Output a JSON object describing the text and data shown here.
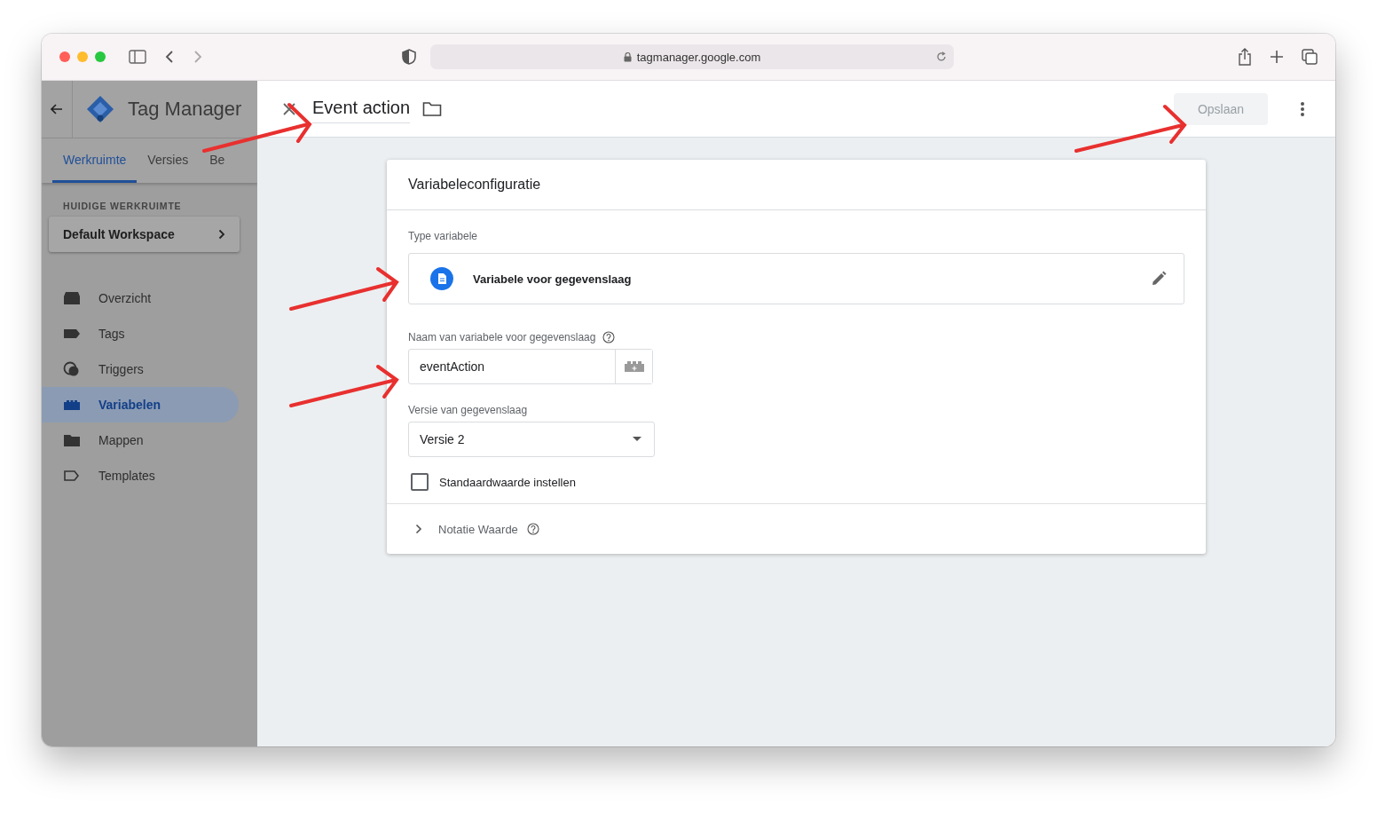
{
  "browser": {
    "url": "tagmanager.google.com"
  },
  "gtm": {
    "app_title": "Tag Manager",
    "tabs": [
      {
        "label": "Werkruimte",
        "selected": true
      },
      {
        "label": "Versies",
        "selected": false
      },
      {
        "label": "Be",
        "selected": false
      }
    ],
    "workspace_heading": "HUIDIGE WERKRUIMTE",
    "workspace": "Default Workspace",
    "nav": [
      {
        "label": "Overzicht",
        "selected": false
      },
      {
        "label": "Tags",
        "selected": false
      },
      {
        "label": "Triggers",
        "selected": false
      },
      {
        "label": "Variabelen",
        "selected": true
      },
      {
        "label": "Mappen",
        "selected": false
      },
      {
        "label": "Templates",
        "selected": false
      }
    ]
  },
  "editor": {
    "title": "Event action",
    "save_button": {
      "label": "Opslaan",
      "disabled": true
    },
    "card": {
      "title": "Variabeleconfiguratie",
      "type_label": "Type variabele",
      "type_value": "Variabele voor gegevenslaag",
      "name_label": "Naam van variabele voor gegevenslaag",
      "name_value": "eventAction",
      "version_label": "Versie van gegevenslaag",
      "version_value": "Versie 2",
      "default_checkbox": {
        "label": "Standaardwaarde instellen",
        "checked": false
      },
      "format_section": {
        "label": "Notatie Waarde",
        "expanded": false
      }
    }
  }
}
